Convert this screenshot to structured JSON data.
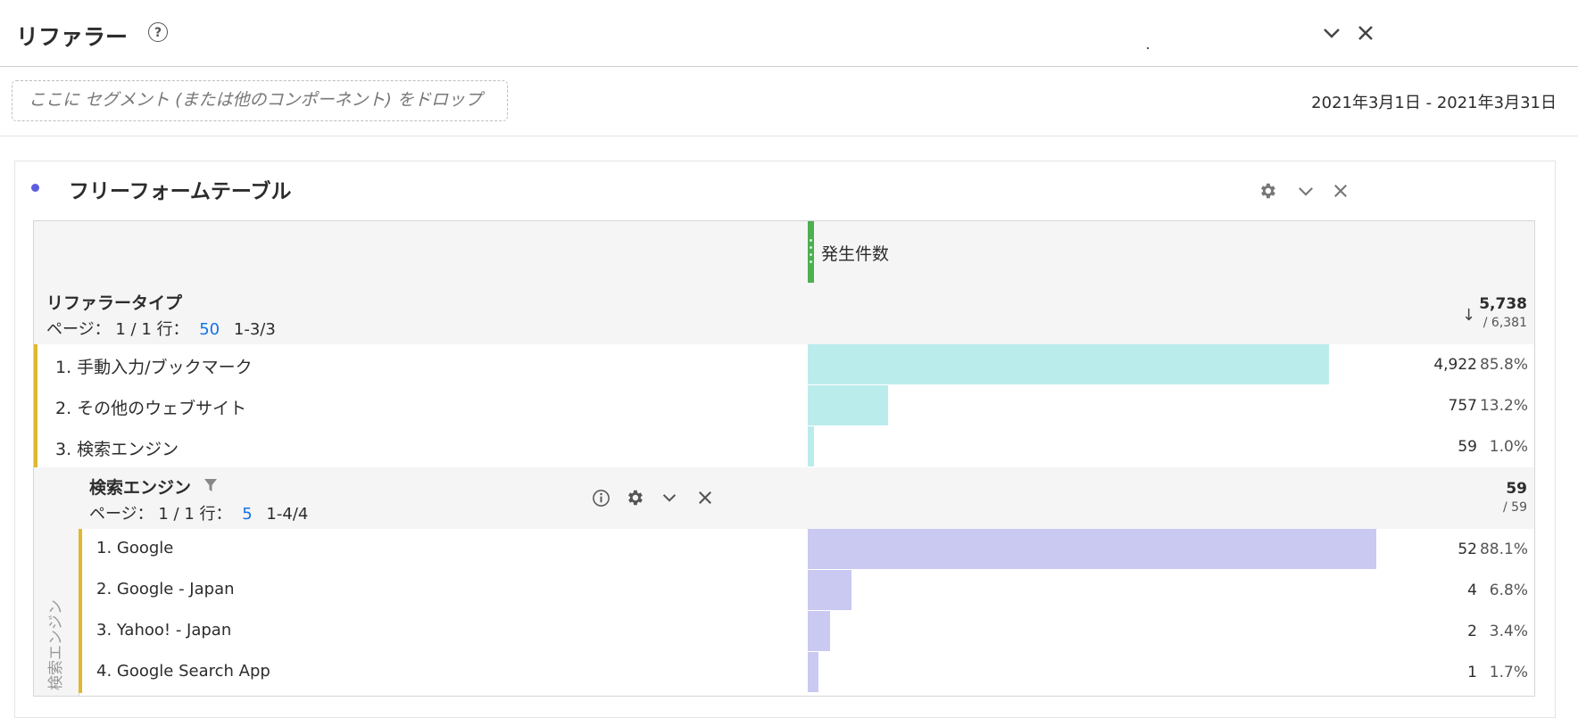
{
  "panel": {
    "title": "リファラー",
    "help_glyph": "?",
    "segment_drop_placeholder": "ここに セグメント (または他のコンポーネント) をドロップ",
    "date_range": "2021年3月1日 - 2021年3月31日"
  },
  "freeform": {
    "title": "フリーフォームテーブル",
    "metric_column": "発生件数",
    "dimension": {
      "title": "リファラータイプ",
      "page_label": "ページ： 1 / 1 行：",
      "rows_per_page": "50",
      "range": "1-3/3",
      "sort_glyph": "↓",
      "total": "5,738",
      "total_of": "/ 6,381"
    },
    "rows": [
      {
        "label": "1. 手動入力/ブックマーク",
        "value": "4,922",
        "pct": "85.8%",
        "share": 0.858
      },
      {
        "label": "2. その他のウェブサイト",
        "value": "757",
        "pct": "13.2%",
        "share": 0.132
      },
      {
        "label": "3. 検索エンジン",
        "value": "59",
        "pct": "1.0%",
        "share": 0.01
      }
    ],
    "breakdown": {
      "side_label": "検索エンジン",
      "title": "検索エンジン",
      "page_label": "ページ： 1 / 1 行：",
      "rows_per_page": "5",
      "range": "1-4/4",
      "total": "59",
      "total_of": "/ 59",
      "rows": [
        {
          "label": "1. Google",
          "value": "52",
          "pct": "88.1%",
          "share": 0.881
        },
        {
          "label": "2. Google - Japan",
          "value": "4",
          "pct": "6.8%",
          "share": 0.068
        },
        {
          "label": "3. Yahoo! - Japan",
          "value": "2",
          "pct": "3.4%",
          "share": 0.034
        },
        {
          "label": "4. Google Search App",
          "value": "1",
          "pct": "1.7%",
          "share": 0.017
        }
      ]
    }
  },
  "colors": {
    "accent_metric": "#4caf50",
    "bar_primary": "#bbecec",
    "bar_breakdown": "#cac9f2",
    "row_accent": "#e0b830",
    "link": "#1473e6"
  }
}
